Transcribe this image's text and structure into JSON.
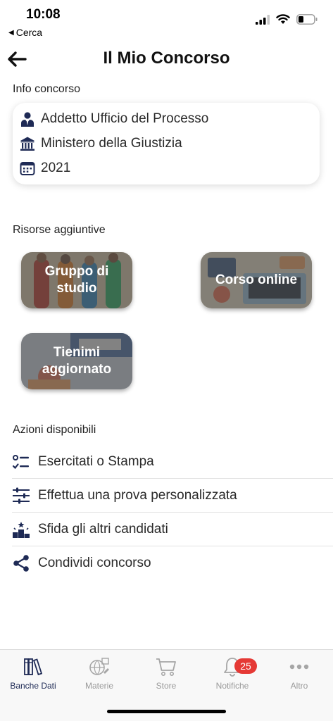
{
  "status_bar": {
    "time": "10:08",
    "back_app": "Cerca"
  },
  "header": {
    "title": "Il Mio Concorso"
  },
  "info": {
    "section_label": "Info concorso",
    "rows": [
      {
        "icon": "person-icon",
        "text": "Addetto Ufficio del Processo"
      },
      {
        "icon": "institution-icon",
        "text": "Ministero della Giustizia"
      },
      {
        "icon": "calendar-icon",
        "text": "2021"
      }
    ]
  },
  "resources": {
    "section_label": "Risorse aggiuntive",
    "tiles": [
      {
        "label": "Gruppo di studio"
      },
      {
        "label": "Corso online"
      },
      {
        "label": "Tienimi aggiornato"
      }
    ]
  },
  "actions": {
    "section_label": "Azioni disponibili",
    "items": [
      {
        "icon": "checklist-icon",
        "label": "Esercitati o Stampa"
      },
      {
        "icon": "sliders-icon",
        "label": "Effettua una prova personalizzata"
      },
      {
        "icon": "podium-icon",
        "label": "Sfida gli altri candidati"
      },
      {
        "icon": "share-icon",
        "label": "Condividi concorso"
      }
    ]
  },
  "tabbar": {
    "tabs": [
      {
        "label": "Banche Dati",
        "icon": "books-icon",
        "active": true
      },
      {
        "label": "Materie",
        "icon": "subjects-icon",
        "active": false
      },
      {
        "label": "Store",
        "icon": "cart-icon",
        "active": false
      },
      {
        "label": "Notifiche",
        "icon": "bell-icon",
        "active": false,
        "badge": "25"
      },
      {
        "label": "Altro",
        "icon": "more-icon",
        "active": false
      }
    ]
  },
  "colors": {
    "accent": "#1e2a55",
    "badge": "#e53935",
    "tile_shade": "#464646"
  }
}
